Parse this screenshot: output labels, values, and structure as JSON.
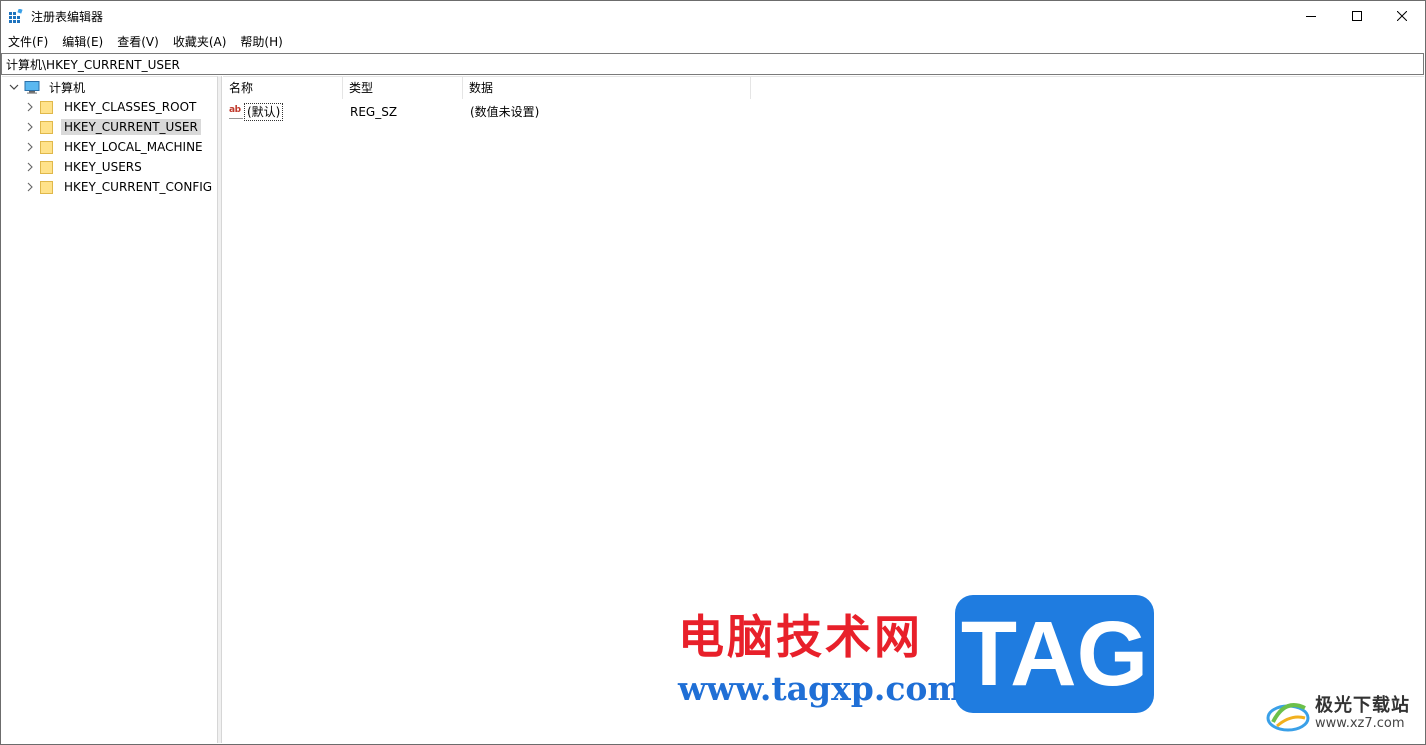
{
  "window": {
    "title": "注册表编辑器",
    "controls": {
      "minimize": "minimize",
      "maximize": "maximize",
      "close": "close"
    }
  },
  "menu": [
    {
      "label": "文件(F)"
    },
    {
      "label": "编辑(E)"
    },
    {
      "label": "查看(V)"
    },
    {
      "label": "收藏夹(A)"
    },
    {
      "label": "帮助(H)"
    }
  ],
  "address": {
    "path": "计算机\\HKEY_CURRENT_USER"
  },
  "tree": {
    "root": {
      "label": "计算机",
      "icon": "computer-icon",
      "expanded": true
    },
    "children": [
      {
        "label": "HKEY_CLASSES_ROOT",
        "selected": false
      },
      {
        "label": "HKEY_CURRENT_USER",
        "selected": true
      },
      {
        "label": "HKEY_LOCAL_MACHINE",
        "selected": false
      },
      {
        "label": "HKEY_USERS",
        "selected": false
      },
      {
        "label": "HKEY_CURRENT_CONFIG",
        "selected": false
      }
    ]
  },
  "list": {
    "columns": [
      "名称",
      "类型",
      "数据"
    ],
    "rows": [
      {
        "icon": "string-value-icon",
        "icon_text": "ab",
        "name": "(默认)",
        "type": "REG_SZ",
        "data": "(数值未设置)"
      }
    ]
  },
  "watermark": {
    "cn": "电脑技术网",
    "url": "www.tagxp.com",
    "tag": "TAG",
    "site2_cn": "极光下载站",
    "site2_url": "www.xz7.com"
  },
  "colors": {
    "selection": "#d9d9d9",
    "watermark_red": "#e8202a",
    "watermark_blue": "#1f7ce0"
  }
}
